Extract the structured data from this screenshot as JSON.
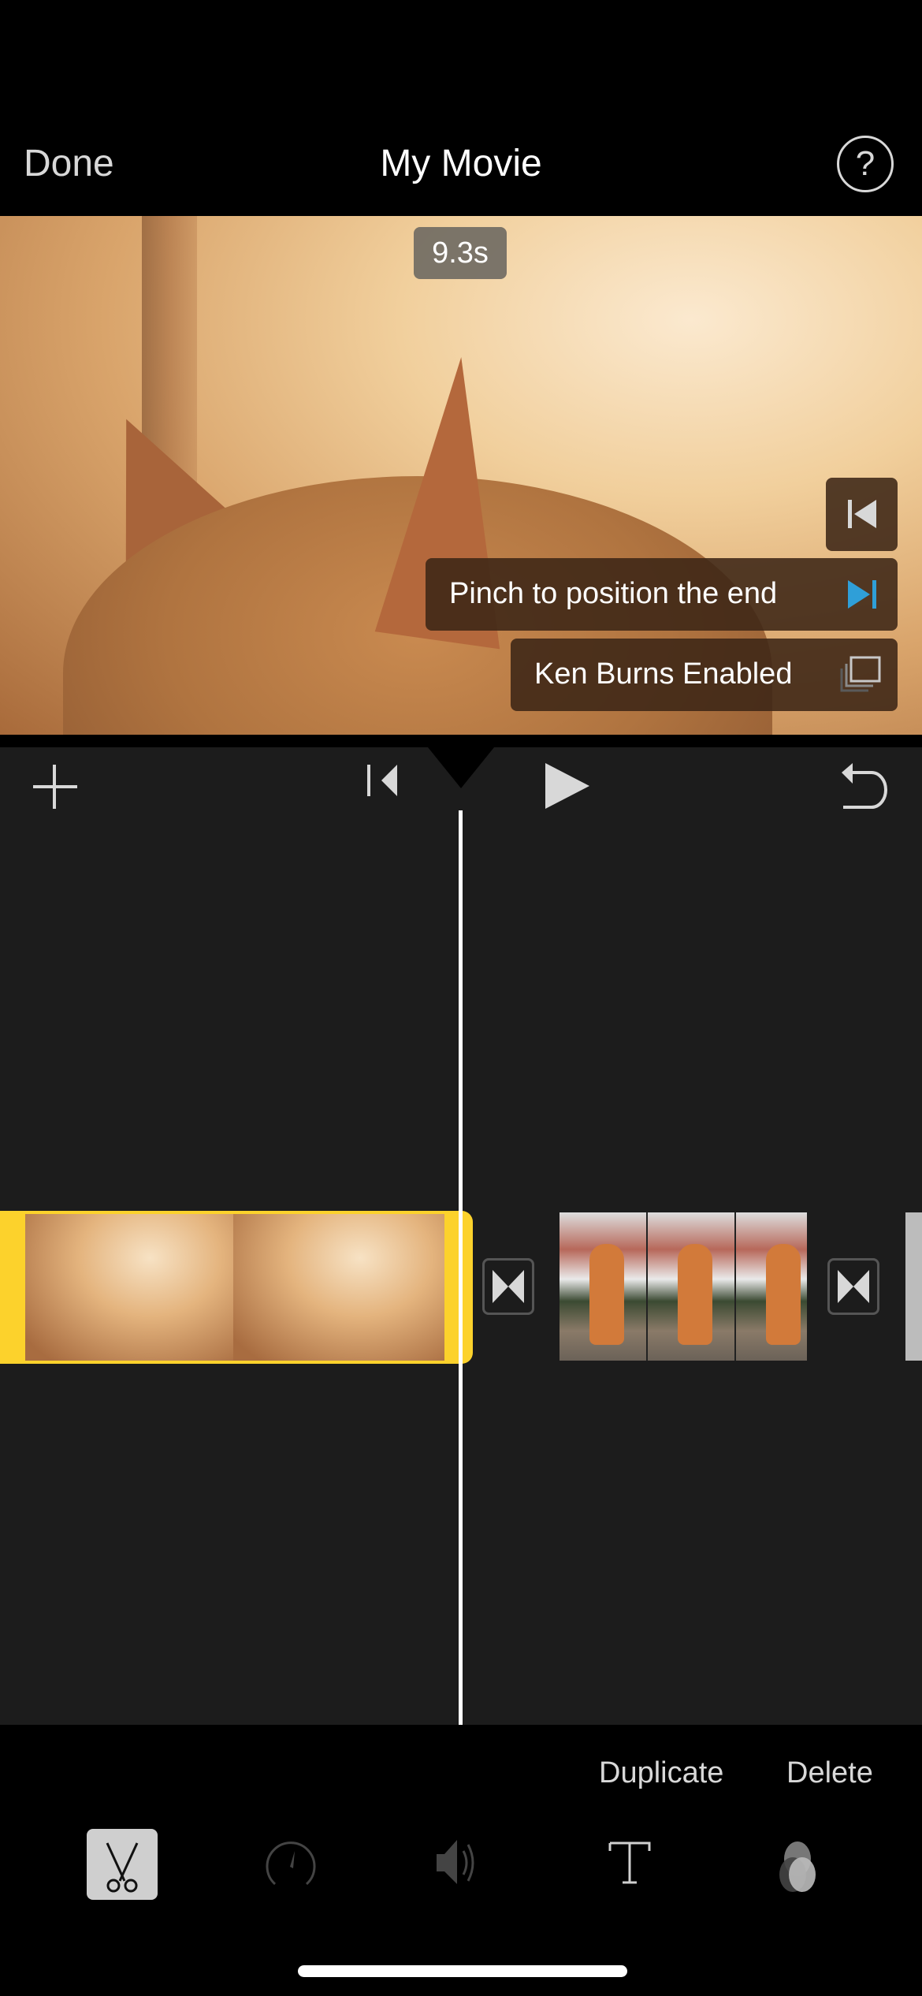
{
  "nav": {
    "done_label": "Done",
    "title": "My Movie",
    "help_label": "?"
  },
  "preview": {
    "duration_badge": "9.3s",
    "overlays": {
      "start_icon": "skip-to-start-icon",
      "pinch_label": "Pinch to position the end",
      "pinch_icon": "skip-to-end-icon",
      "ken_burns_label": "Ken Burns Enabled",
      "ken_burns_icon": "ken-burns-stack-icon"
    },
    "accent_color": "#2f9fd8"
  },
  "controls": {
    "add_icon": "plus-icon",
    "rewind_icon": "skip-back-icon",
    "play_icon": "play-icon",
    "undo_icon": "undo-icon"
  },
  "timeline": {
    "selected_clip": {
      "description": "Cat ears backlit",
      "selection_color": "#fcd22c",
      "thumbnail_count": 2
    },
    "clips": [
      {
        "description": "Orange cat sitting on street",
        "thumbnail_count": 3
      },
      {
        "description": "Grey clip (partially visible)"
      }
    ],
    "transitions": 2
  },
  "actions": {
    "duplicate_label": "Duplicate",
    "delete_label": "Delete"
  },
  "toolbar": {
    "tools": [
      {
        "name": "scissors-icon",
        "selected": true
      },
      {
        "name": "speed-icon",
        "selected": false
      },
      {
        "name": "volume-icon",
        "selected": false
      },
      {
        "name": "title-text-icon",
        "selected": false
      },
      {
        "name": "filters-icon",
        "selected": false
      }
    ]
  }
}
